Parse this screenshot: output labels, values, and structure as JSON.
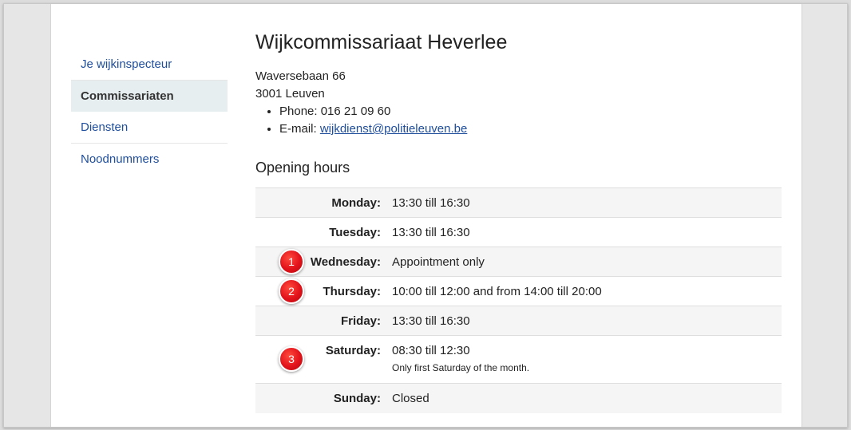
{
  "sidebar": {
    "items": [
      {
        "label": "Je wijkinspecteur",
        "active": false
      },
      {
        "label": "Commissariaten",
        "active": true
      },
      {
        "label": "Diensten",
        "active": false
      },
      {
        "label": "Noodnummers",
        "active": false
      }
    ]
  },
  "main": {
    "title": "Wijkcommissariaat Heverlee",
    "address_line1": "Waversebaan 66",
    "address_line2": "3001 Leuven",
    "phone": "Phone: 016 21 09 60",
    "email_prefix": "E-mail: ",
    "email": "wijkdienst@politieleuven.be",
    "hours_heading": "Opening hours"
  },
  "hours": [
    {
      "day": "Monday:",
      "time": "13:30 till 16:30"
    },
    {
      "day": "Tuesday:",
      "time": "13:30 till 16:30"
    },
    {
      "day": "Wednesday:",
      "time": "Appointment only"
    },
    {
      "day": "Thursday:",
      "time": "10:00 till 12:00 and from 14:00 till 20:00"
    },
    {
      "day": "Friday:",
      "time": "13:30 till 16:30"
    },
    {
      "day": "Saturday:",
      "time": "08:30 till 12:30",
      "note": "Only first Saturday of the month."
    },
    {
      "day": "Sunday:",
      "time": "Closed"
    }
  ],
  "markers": [
    "1",
    "2",
    "3"
  ],
  "colors": {
    "link": "#1f4e9c",
    "active_bg": "#e6eeef",
    "marker": "#e2121a"
  }
}
